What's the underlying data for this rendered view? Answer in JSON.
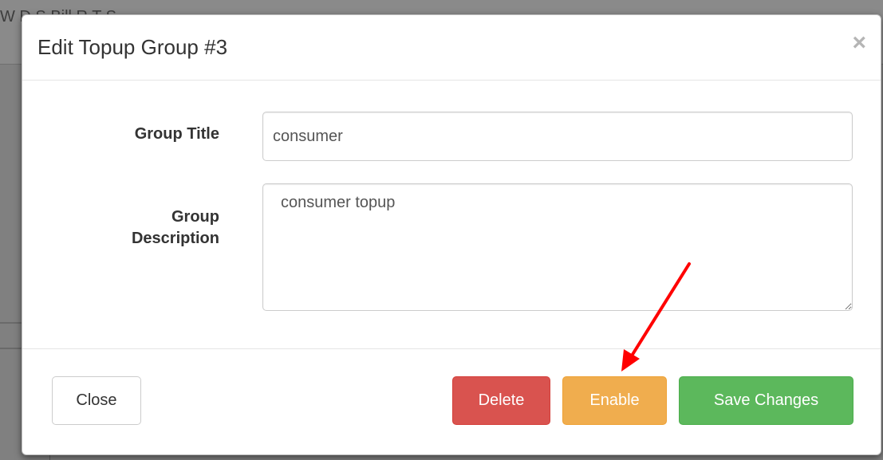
{
  "backdrop": {
    "nav_text": "W          D        S        Bill        R        T        S"
  },
  "modal": {
    "title": "Edit Topup Group #3",
    "close_symbol": "×",
    "fields": {
      "group_title_label": "Group Title",
      "group_title_value": "consumer",
      "group_description_label_line1": "Group",
      "group_description_label_line2": "Description",
      "group_description_value": "consumer topup"
    },
    "footer": {
      "close_label": "Close",
      "delete_label": "Delete",
      "enable_label": "Enable",
      "save_label": "Save Changes"
    }
  },
  "colors": {
    "danger": "#d9534f",
    "warning": "#f0ad4e",
    "success": "#5cb85c",
    "annotation_arrow": "#ff0000"
  },
  "icons": {
    "close": "close-icon",
    "annotation": "red-arrow-annotation",
    "resize": "textarea-resize-handle"
  }
}
